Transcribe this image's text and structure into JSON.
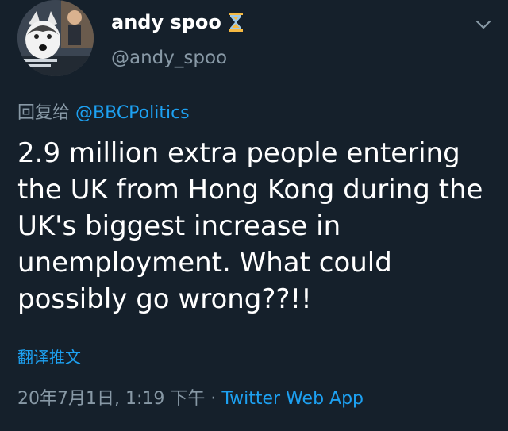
{
  "user": {
    "display_name": "andy spoo",
    "name_emoji_icon": "hourglass-icon",
    "handle": "@andy_spoo",
    "avatar_icon": "husky-dog-avatar"
  },
  "reply": {
    "prefix": "回复给",
    "mention": "@BBCPolitics"
  },
  "tweet": {
    "text": "2.9 million extra people entering the UK from Hong Kong during the UK's biggest increase in unemployment. What could possibly go wrong??!!"
  },
  "translate_label": "翻译推文",
  "meta": {
    "timestamp": "20年7月1日, 1:19 下午",
    "separator": " · ",
    "source": "Twitter Web App"
  },
  "colors": {
    "background": "#15202b",
    "text": "#ffffff",
    "secondary": "#8899a6",
    "accent": "#1da1f2"
  }
}
